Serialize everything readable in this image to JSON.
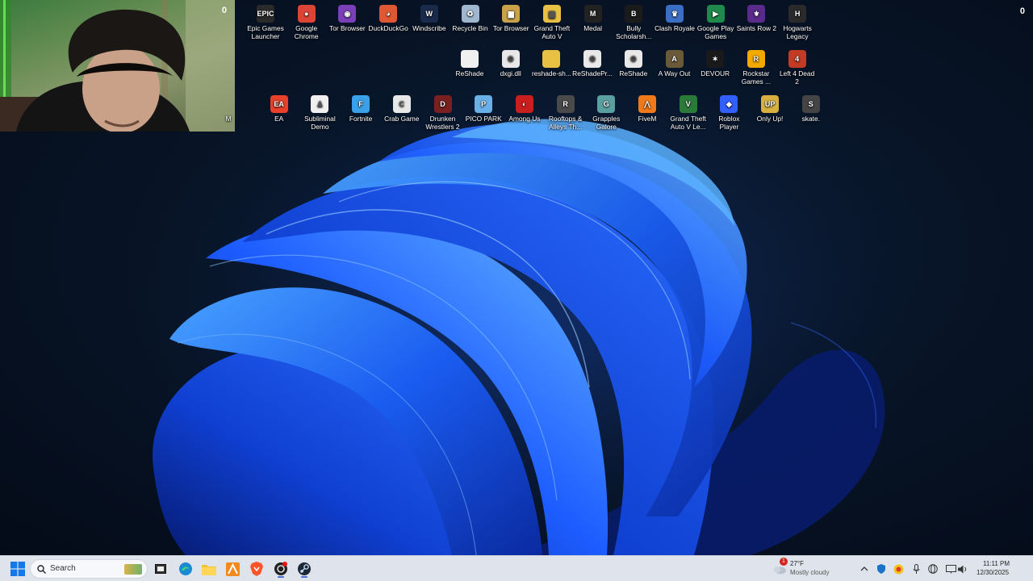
{
  "overlay": {
    "counter": "0"
  },
  "icons_row1": [
    {
      "label": "Epic Games Launcher",
      "name": "epic-games-launcher",
      "color": "#2b2b2b",
      "glyph": "EPIC"
    },
    {
      "label": "Google Chrome",
      "name": "google-chrome",
      "color": "#db4437",
      "glyph": "●"
    },
    {
      "label": "Tor Browser",
      "name": "tor-browser",
      "color": "#7b3fb8",
      "glyph": "◉"
    },
    {
      "label": "DuckDuckGo",
      "name": "duckduckgo",
      "color": "#de5833",
      "glyph": "◕"
    },
    {
      "label": "Windscribe",
      "name": "windscribe",
      "color": "#1a2a4a",
      "glyph": "W"
    },
    {
      "label": "Recycle Bin",
      "name": "recycle-bin",
      "color": "#9fb8d0",
      "glyph": "♻"
    },
    {
      "label": "Tor Browser",
      "name": "tor-browser-2",
      "color": "#c9a34a",
      "glyph": "▆"
    },
    {
      "label": "Grand Theft Auto V",
      "name": "gta-v-folder",
      "color": "#e8c144",
      "glyph": "▆"
    },
    {
      "label": "Medal",
      "name": "medal",
      "color": "#222",
      "glyph": "M"
    },
    {
      "label": "Bully Scholarsh...",
      "name": "bully",
      "color": "#1b1b1b",
      "glyph": "B"
    },
    {
      "label": "Clash Royale",
      "name": "clash-royale",
      "color": "#3a6fc4",
      "glyph": "♛"
    },
    {
      "label": "Google Play Games",
      "name": "google-play-games",
      "color": "#1f8a4c",
      "glyph": "▶"
    },
    {
      "label": "Saints Row 2",
      "name": "saints-row-2",
      "color": "#5a2b8a",
      "glyph": "⚜"
    },
    {
      "label": "Hogwarts Legacy",
      "name": "hogwarts-legacy",
      "color": "#2a2a2a",
      "glyph": "H"
    }
  ],
  "icons_row2": [
    {
      "label": "ReShade",
      "name": "reshade-file",
      "color": "#f0f0f0",
      "glyph": ""
    },
    {
      "label": "dxgi.dll",
      "name": "dxgi-dll",
      "color": "#e8e8e8",
      "glyph": "⚙"
    },
    {
      "label": "reshade-sh...",
      "name": "reshade-shaders",
      "color": "#e8c144",
      "glyph": ""
    },
    {
      "label": "ReShadePr...",
      "name": "reshade-preset",
      "color": "#e8e8e8",
      "glyph": "⚙"
    },
    {
      "label": "ReShade",
      "name": "reshade-2",
      "color": "#e8e8e8",
      "glyph": "⚙"
    },
    {
      "label": "A Way Out",
      "name": "a-way-out",
      "color": "#6b5a3a",
      "glyph": "A"
    },
    {
      "label": "DEVOUR",
      "name": "devour",
      "color": "#1a1a1a",
      "glyph": "✶"
    },
    {
      "label": "Rockstar Games ...",
      "name": "rockstar-games",
      "color": "#f2a900",
      "glyph": "R"
    },
    {
      "label": "Left 4 Dead 2",
      "name": "left-4-dead-2",
      "color": "#c23b22",
      "glyph": "4"
    }
  ],
  "icons_row3": [
    {
      "label": "M",
      "name": "partial-icon",
      "color": "",
      "glyph": ""
    },
    {
      "label": "EA",
      "name": "ea",
      "color": "#e8402a",
      "glyph": "EA"
    },
    {
      "label": "Subliminal Demo",
      "name": "subliminal-demo",
      "color": "#f0f0f0",
      "glyph": "♟"
    },
    {
      "label": "Fortnite",
      "name": "fortnite",
      "color": "#3aa0e8",
      "glyph": "F"
    },
    {
      "label": "Crab Game",
      "name": "crab-game",
      "color": "#e8e8e8",
      "glyph": "C"
    },
    {
      "label": "Drunken Wrestlers 2",
      "name": "drunken-wrestlers-2",
      "color": "#7a2020",
      "glyph": "D"
    },
    {
      "label": "PICO PARK",
      "name": "pico-park",
      "color": "#6ab0e8",
      "glyph": "P"
    },
    {
      "label": "Among Us",
      "name": "among-us",
      "color": "#c81e1e",
      "glyph": "◐"
    },
    {
      "label": "Rooftops & Alleys Th...",
      "name": "rooftops-alleys",
      "color": "#4a4a4a",
      "glyph": "R"
    },
    {
      "label": "Grapples Galore",
      "name": "grapples-galore",
      "color": "#5aa0a0",
      "glyph": "G"
    },
    {
      "label": "FiveM",
      "name": "fivem",
      "color": "#f07a1a",
      "glyph": "⋀"
    },
    {
      "label": "Grand Theft Auto V Le...",
      "name": "gta-v-legacy",
      "color": "#2a7a3a",
      "glyph": "V"
    },
    {
      "label": "Roblox Player",
      "name": "roblox-player",
      "color": "#335fff",
      "glyph": "◆"
    },
    {
      "label": "Only Up!",
      "name": "only-up",
      "color": "#d8b040",
      "glyph": "UP"
    },
    {
      "label": "skate.",
      "name": "skate",
      "color": "#444",
      "glyph": "S"
    }
  ],
  "taskbar": {
    "search_placeholder": "Search",
    "weather_temp": "27°F",
    "weather_desc": "Mostly cloudy",
    "weather_badge": "1",
    "time": "11:11 PM",
    "date": "12/30/2025"
  }
}
